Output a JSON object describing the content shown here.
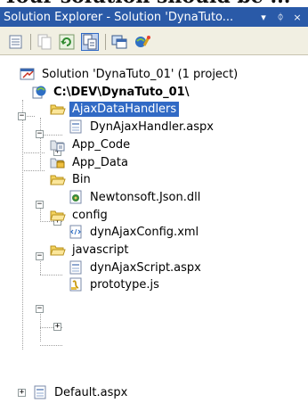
{
  "window": {
    "title": "Solution Explorer - Solution 'DynaTuto...",
    "dropdown_glyph": "▾",
    "pin_glyph": "ᛰ",
    "close_glyph": "×"
  },
  "toolbar": {
    "buttons": [
      {
        "name": "properties-icon",
        "enabled": true
      },
      {
        "name": "show-all-files-icon",
        "enabled": false
      },
      {
        "name": "refresh-icon",
        "enabled": true
      },
      {
        "name": "nest-related-files-icon",
        "enabled": true,
        "selected": true
      },
      {
        "name": "view-designer-icon",
        "enabled": true
      },
      {
        "name": "asp-net-configuration-icon",
        "enabled": true
      }
    ]
  },
  "tree": {
    "solution": "Solution 'DynaTuto_01' (1 project)",
    "project": "C:\\DEV\\DynaTuto_01\\",
    "items": {
      "ajaxdatahandlers": "AjaxDataHandlers",
      "dynajaxhandler": "DynAjaxHandler.aspx",
      "app_code": "App_Code",
      "app_data": "App_Data",
      "bin": "Bin",
      "newtonsoft": "Newtonsoft.Json.dll",
      "config": "config",
      "dynajaxconfig": "dynAjaxConfig.xml",
      "javascript": "javascript",
      "dynajaxscript": "dynAjaxScript.aspx",
      "prototype": "prototype.js",
      "default": "Default.aspx"
    },
    "selected": "AjaxDataHandlers"
  },
  "expand_glyphs": {
    "expanded": "−",
    "collapsed": "+"
  }
}
